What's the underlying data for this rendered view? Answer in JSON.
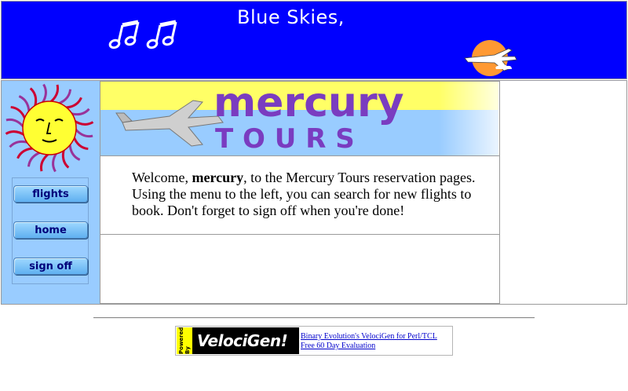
{
  "banner": {
    "title": "Blue Skies,",
    "notes_icon": "music-notes-icon",
    "plane_icon": "sun-plane-icon"
  },
  "sidebar": {
    "sun_icon": "sun-face-icon",
    "nav": [
      {
        "label": "flights"
      },
      {
        "label": "home"
      },
      {
        "label": "sign off"
      }
    ]
  },
  "logo": {
    "word1": "mercury",
    "word2": "T O U R S"
  },
  "welcome": {
    "prefix": "Welcome, ",
    "username": "mercury",
    "suffix": ", to the Mercury Tours reservation pages. Using the menu to the left, you can search for new flights to book. Don't forget to sign off when you're done!"
  },
  "footer": {
    "powered": "Powered By",
    "logo_text": "VelociGen!",
    "link1": "Binary Evolution's VelociGen for Perl/TCL",
    "link2": "Free 60 Day Evaluation"
  },
  "colors": {
    "banner": "#0000ff",
    "sidebar": "#99ccff",
    "logo_top": "#ffff66",
    "logo_bottom": "#99ccff"
  }
}
